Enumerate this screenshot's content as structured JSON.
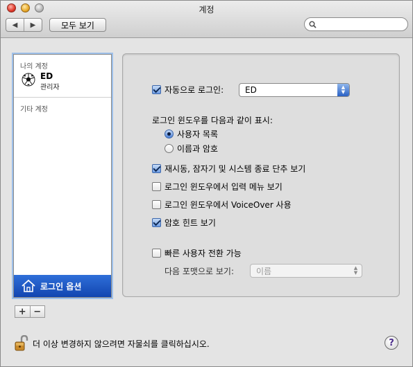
{
  "window": {
    "title": "계정"
  },
  "toolbar": {
    "back_glyph": "◀",
    "forward_glyph": "▶",
    "show_all_label": "모두 보기",
    "search_placeholder": ""
  },
  "sidebar": {
    "my_accounts_header": "나의 계정",
    "accounts": [
      {
        "name": "ED",
        "role": "관리자",
        "icon": "soccer-ball-icon"
      }
    ],
    "other_accounts_header": "기타 계정",
    "login_options_label": "로그인 옵션",
    "add_glyph": "+",
    "remove_glyph": "−"
  },
  "options": {
    "auto_login": {
      "label": "자동으로 로그인:",
      "checked": true,
      "value": "ED"
    },
    "display_header": "로그인 윈도우를 다음과 같이 표시:",
    "radio_list": {
      "label": "사용자 목록",
      "selected": true
    },
    "radio_name_password": {
      "label": "이름과 암호",
      "selected": false
    },
    "show_restart": {
      "label": "재시동, 잠자기 및 시스템 종료 단추 보기",
      "checked": true
    },
    "show_input_menu": {
      "label": "로그인 윈도우에서 입력 메뉴 보기",
      "checked": false
    },
    "voiceover": {
      "label": "로그인 윈도우에서 VoiceOver 사용",
      "checked": false
    },
    "password_hints": {
      "label": "암호 힌트 보기",
      "checked": true
    },
    "fast_user_switching": {
      "label": "빠른 사용자 전환 가능",
      "checked": false
    },
    "view_as": {
      "label": "다음 포맷으로 보기:",
      "value": "이름"
    }
  },
  "footer": {
    "lock_text": "더 이상 변경하지 않으려면 자물쇠를 클릭하십시오.",
    "help_glyph": "?"
  }
}
